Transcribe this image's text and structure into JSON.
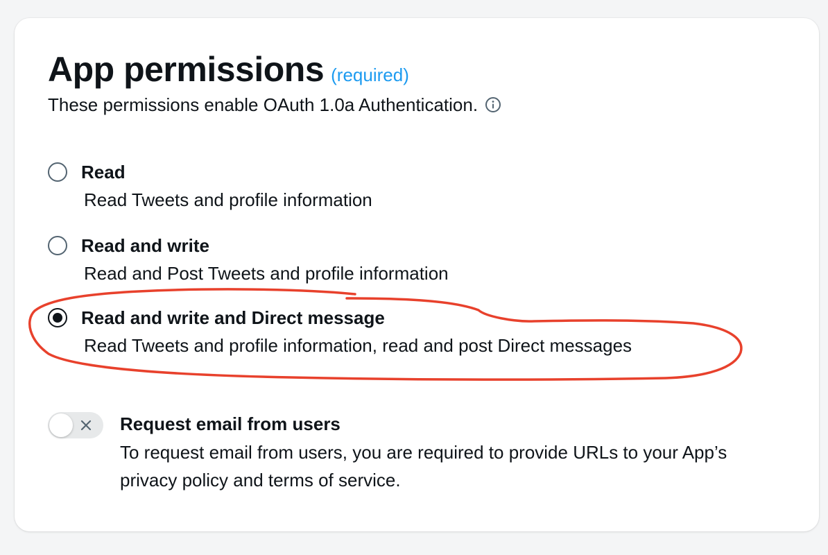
{
  "header": {
    "title": "App permissions",
    "required_label": "(required)",
    "subtitle": "These permissions enable OAuth 1.0a Authentication."
  },
  "options": [
    {
      "label": "Read",
      "description": "Read Tweets and profile information",
      "selected": false
    },
    {
      "label": "Read and write",
      "description": "Read and Post Tweets and profile information",
      "selected": false
    },
    {
      "label": "Read and write and Direct message",
      "description": "Read Tweets and profile information, read and post Direct messages",
      "selected": true
    }
  ],
  "email_toggle": {
    "label": "Request email from users",
    "description": "To request email from users, you are required to provide URLs to your App’s privacy policy and terms of service.",
    "enabled": false
  },
  "colors": {
    "accent": "#1d9bf0",
    "text": "#0f1419",
    "annotation": "#e8412c"
  },
  "icons": {
    "info": "info-icon",
    "toggle_off": "close-icon"
  }
}
